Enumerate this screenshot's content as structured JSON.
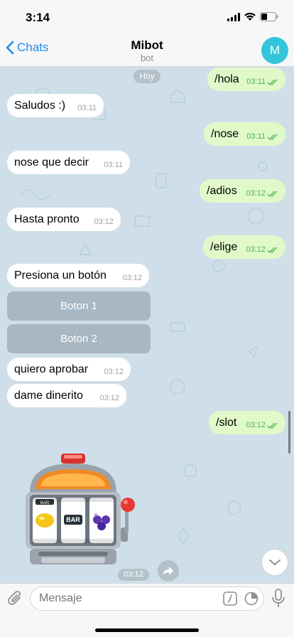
{
  "status": {
    "time": "3:14"
  },
  "header": {
    "back_label": "Chats",
    "title": "Mibot",
    "subtitle": "bot",
    "avatar_letter": "M"
  },
  "date_label": "Hoy",
  "messages": [
    {
      "text": "/hola",
      "time": "03:11",
      "dir": "out"
    },
    {
      "text": "Saludos :)",
      "time": "03:11",
      "dir": "in"
    },
    {
      "text": "/nose",
      "time": "03:11",
      "dir": "out"
    },
    {
      "text": "nose que decir",
      "time": "03:11",
      "dir": "in"
    },
    {
      "text": "/adios",
      "time": "03:12",
      "dir": "out"
    },
    {
      "text": "Hasta pronto",
      "time": "03:12",
      "dir": "in"
    },
    {
      "text": "/elige",
      "time": "03:12",
      "dir": "out"
    },
    {
      "text": "Presiona un botón",
      "time": "03:12",
      "dir": "in"
    },
    {
      "text": "quiero aprobar",
      "time": "03:12",
      "dir": "in"
    },
    {
      "text": "dame dinerito",
      "time": "03:12",
      "dir": "in"
    },
    {
      "text": "/slot",
      "time": "03:12",
      "dir": "out"
    }
  ],
  "keyboard_buttons": [
    "Boton 1",
    "Boton 2"
  ],
  "slot": {
    "time": "03:12",
    "reel_center_label": "BAR",
    "reel_top_label": "BAR"
  },
  "input": {
    "placeholder": "Mensaje"
  },
  "colors": {
    "accent": "#1a8cf0",
    "avatar": "#33c6da",
    "outgoing": "#e1f9c9",
    "incoming": "#ffffff",
    "check": "#4caf50"
  }
}
